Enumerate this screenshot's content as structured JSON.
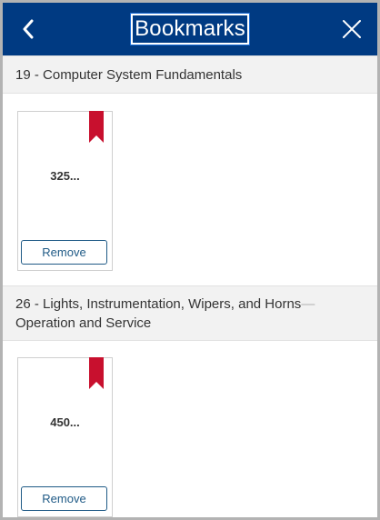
{
  "header": {
    "title": "Bookmarks",
    "back_icon": "chevron-left-icon",
    "close_icon": "close-icon",
    "background_color": "#003a82"
  },
  "sections": [
    {
      "title": "19 - Computer System Fundamentals",
      "title_continued": "",
      "cards": [
        {
          "label": "325...",
          "remove_label": "Remove",
          "ribbon_icon": "bookmark-ribbon-icon",
          "ribbon_color": "#c8102e"
        }
      ]
    },
    {
      "title": "26 - Lights, Instrumentation, Wipers, and Horns",
      "title_separator": "—",
      "title_continued": "Operation and Service",
      "cards": [
        {
          "label": "450...",
          "remove_label": "Remove",
          "ribbon_icon": "bookmark-ribbon-icon",
          "ribbon_color": "#c8102e"
        }
      ]
    }
  ]
}
